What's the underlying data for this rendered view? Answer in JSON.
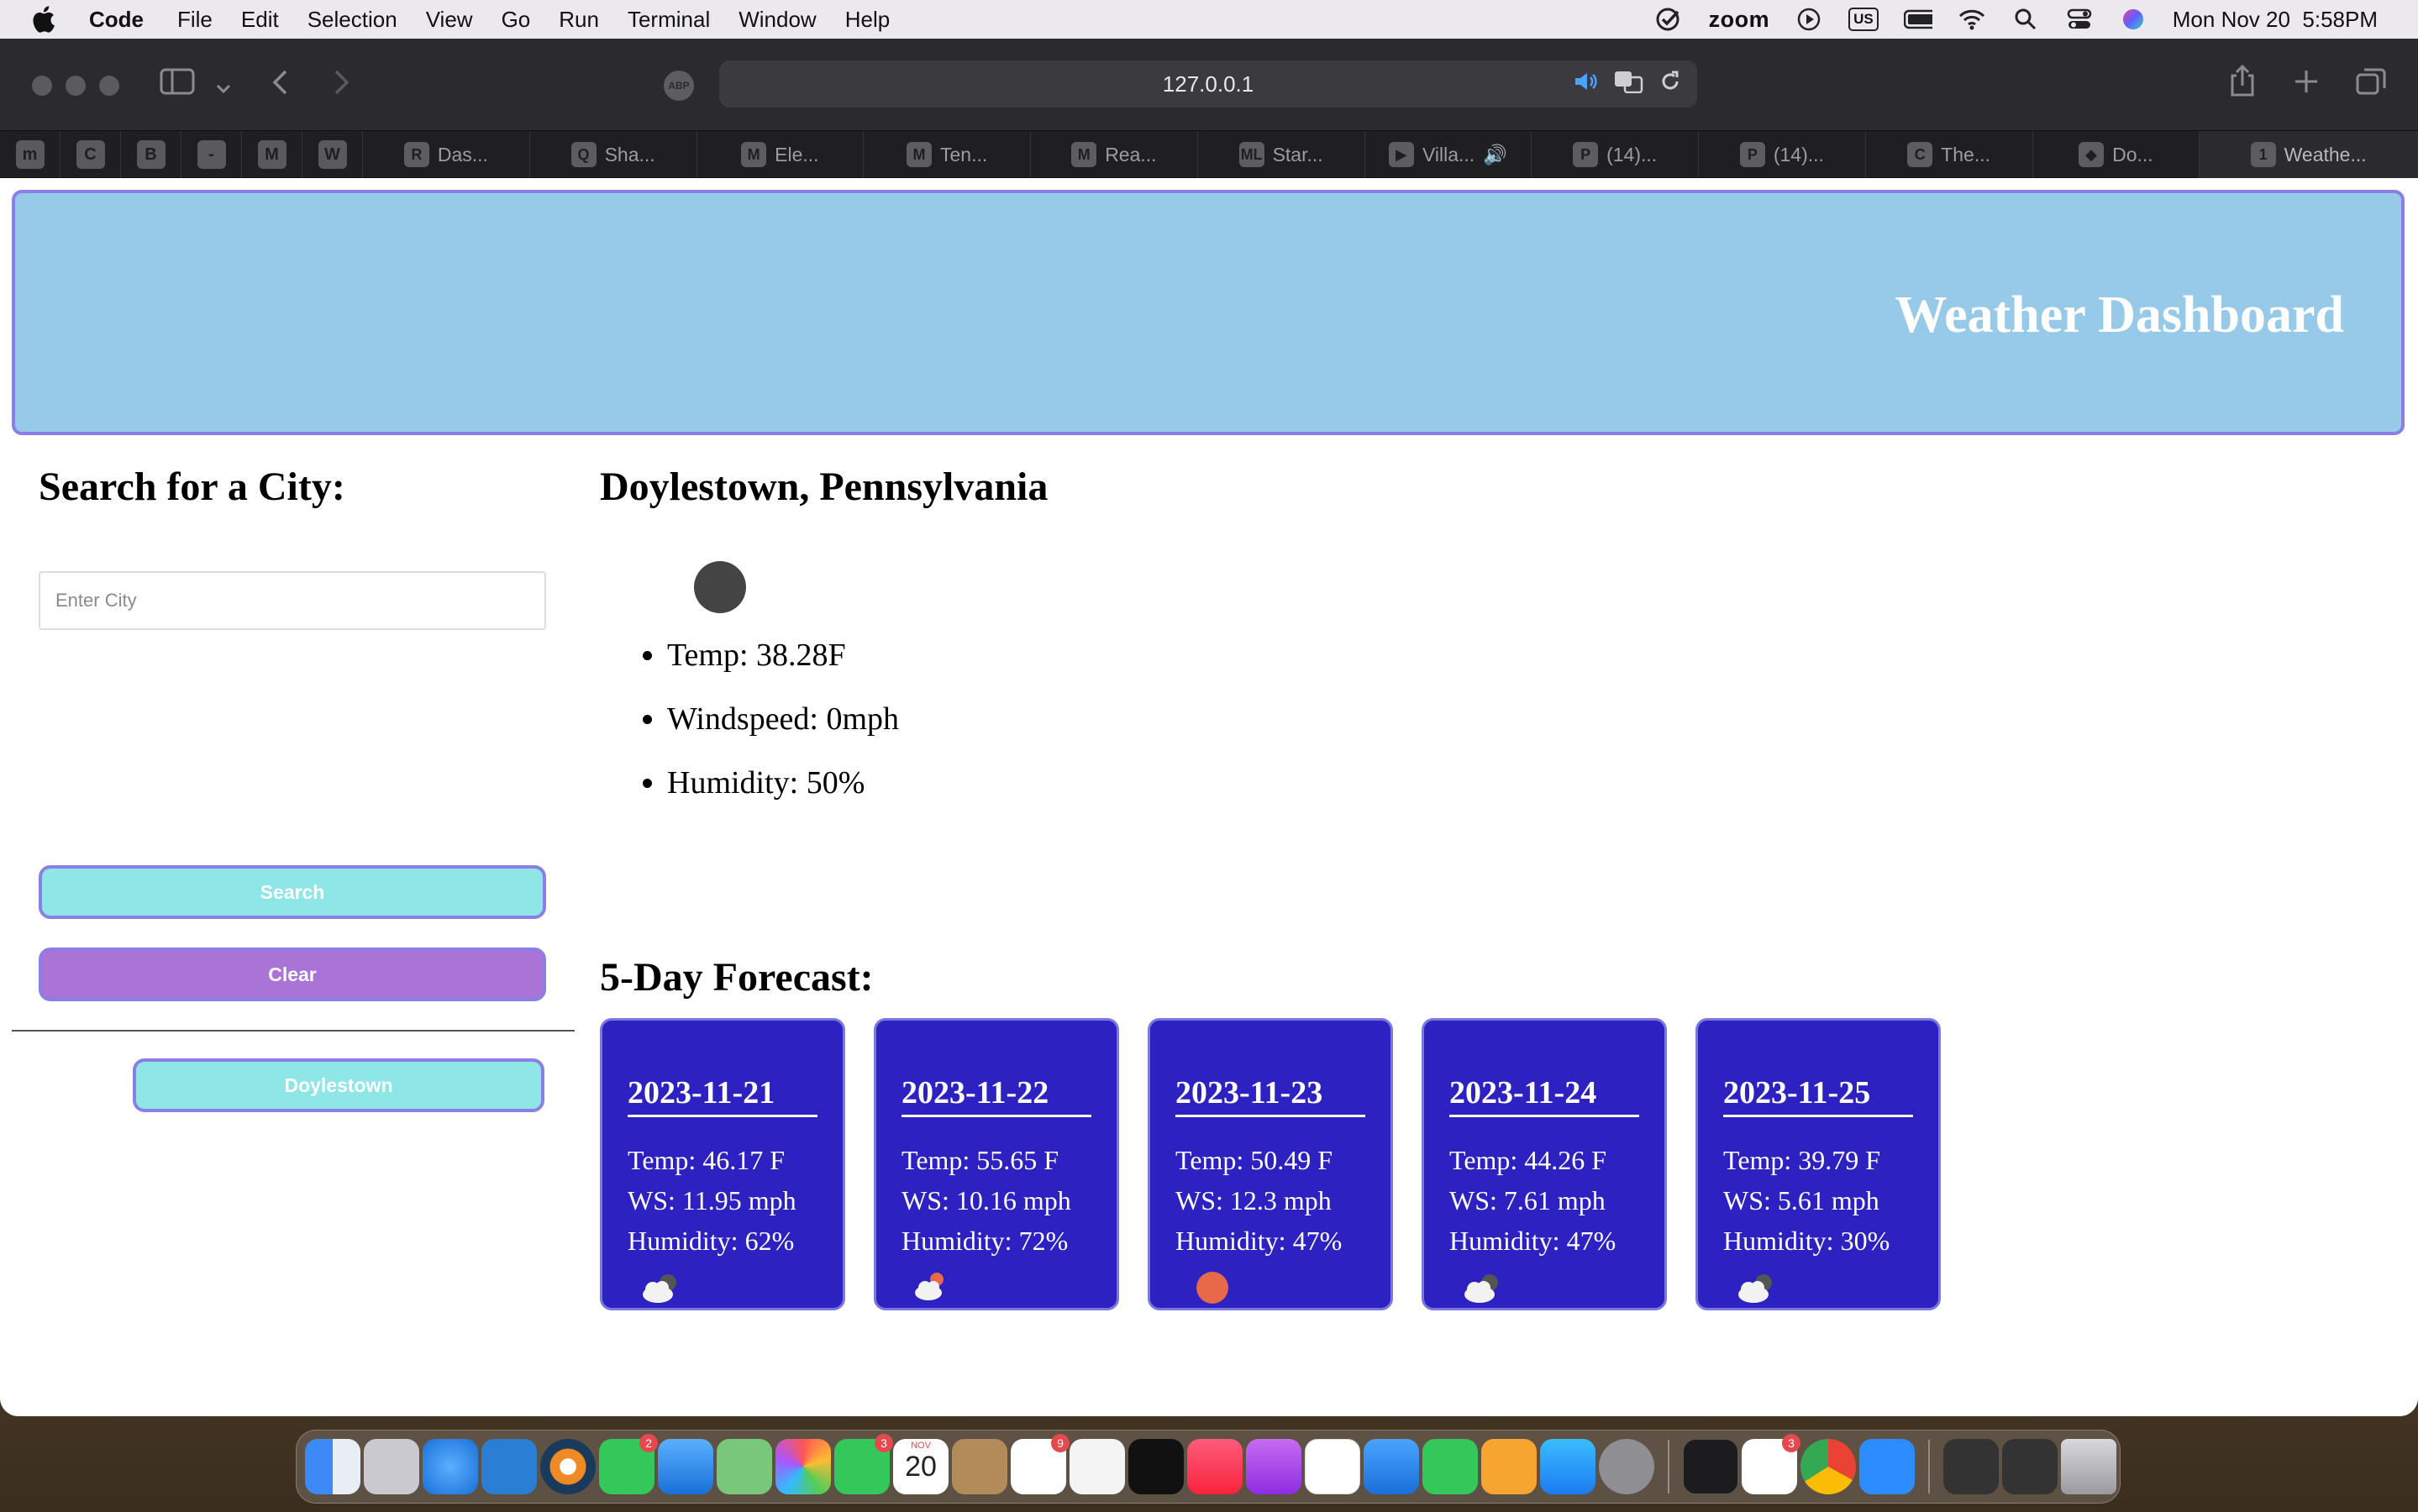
{
  "menubar": {
    "app_name": "Code",
    "items": [
      "File",
      "Edit",
      "Selection",
      "View",
      "Go",
      "Run",
      "Terminal",
      "Window",
      "Help"
    ],
    "zoom_label": "zoom",
    "input_source": "US",
    "datetime": "Mon Nov 20  5:58PM"
  },
  "browser": {
    "url": "127.0.0.1",
    "abp_label": "ABP",
    "pinned_tabs": [
      "m",
      "C",
      "B",
      "-",
      "M",
      "W"
    ],
    "tabs": [
      {
        "icon": "R",
        "title": "Das..."
      },
      {
        "icon": "Q",
        "title": "Sha..."
      },
      {
        "icon": "M",
        "title": "Ele..."
      },
      {
        "icon": "M",
        "title": "Ten..."
      },
      {
        "icon": "M",
        "title": "Rea..."
      },
      {
        "icon": "ML",
        "title": "Star..."
      },
      {
        "icon": "▶",
        "title": "Villa..."
      },
      {
        "icon": "P",
        "title": "(14)..."
      },
      {
        "icon": "P",
        "title": "(14)..."
      },
      {
        "icon": "C",
        "title": "The..."
      },
      {
        "icon": "◆",
        "title": "Do..."
      }
    ],
    "active_tab": {
      "icon": "1",
      "title": "Weathe..."
    }
  },
  "page": {
    "header_title": "Weather Dashboard",
    "search": {
      "heading": "Search for a City:",
      "placeholder": "Enter City",
      "search_label": "Search",
      "clear_label": "Clear"
    },
    "history": [
      "Doylestown"
    ],
    "current": {
      "city": "Doylestown, Pennsylvania",
      "temp": "Temp: 38.28F",
      "wind": "Windspeed: 0mph",
      "humidity": "Humidity: 50%"
    },
    "forecast_title": "5-Day Forecast:",
    "forecast": [
      {
        "date": "2023-11-21",
        "temp": "Temp: 46.17 F",
        "ws": "WS: 11.95 mph",
        "humidity": "Humidity: 62%",
        "icon": "cloudy-night-icon"
      },
      {
        "date": "2023-11-22",
        "temp": "Temp: 55.65 F",
        "ws": "WS: 10.16 mph",
        "humidity": "Humidity: 72%",
        "icon": "cloud-sun-icon"
      },
      {
        "date": "2023-11-23",
        "temp": "Temp: 50.49 F",
        "ws": "WS: 12.3 mph",
        "humidity": "Humidity: 47%",
        "icon": "sun-icon"
      },
      {
        "date": "2023-11-24",
        "temp": "Temp: 44.26 F",
        "ws": "WS: 7.61 mph",
        "humidity": "Humidity: 47%",
        "icon": "cloudy-night-icon"
      },
      {
        "date": "2023-11-25",
        "temp": "Temp: 39.79 F",
        "ws": "WS: 5.61 mph",
        "humidity": "Humidity: 30%",
        "icon": "cloudy-night-icon"
      }
    ]
  },
  "dock": {
    "calendar_day": "20",
    "calendar_month": "NOV",
    "badges": {
      "messages": "2",
      "facetime": "3",
      "reminders": "9",
      "slack": "3"
    }
  },
  "colors": {
    "header_bg": "#97cae8",
    "accent_border": "#8a7fe6",
    "search_btn": "#8ee6e6",
    "clear_btn": "#a974d6",
    "card_bg": "#2d21c2"
  }
}
